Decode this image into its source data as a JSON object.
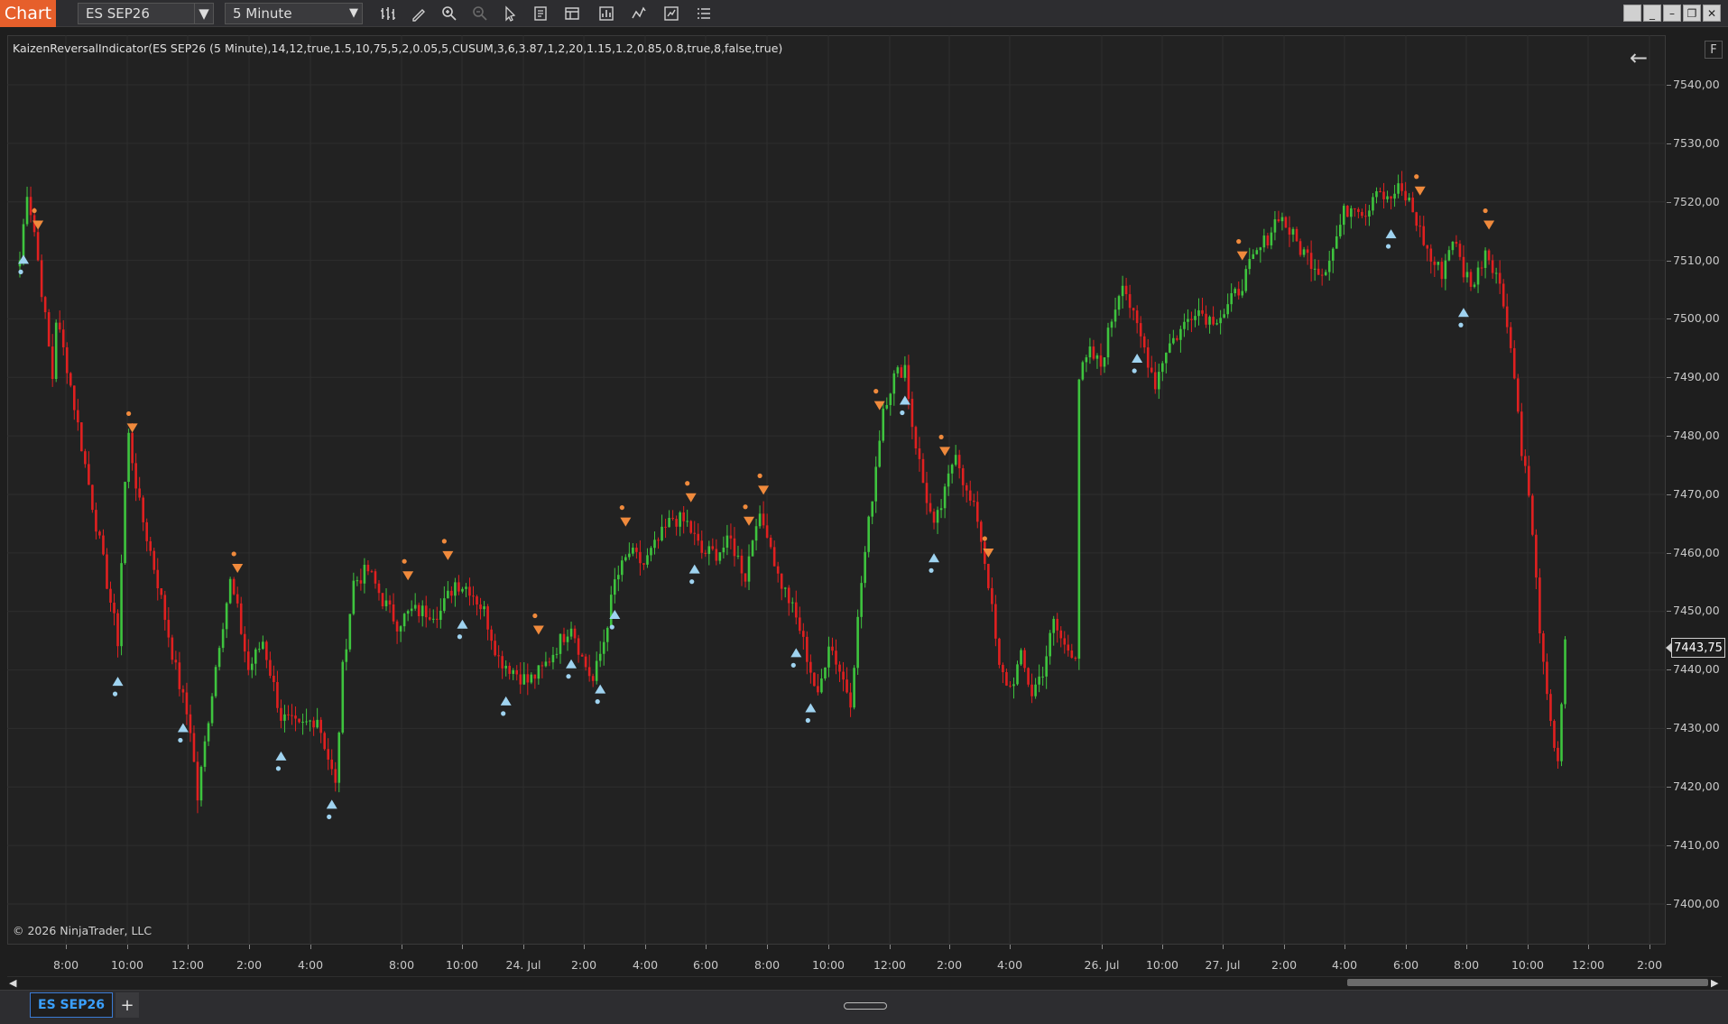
{
  "toolbar": {
    "brand": "Chart",
    "instrument": "ES SEP26",
    "interval": "5 Minute",
    "icons": [
      "bar-type-icon",
      "draw-tool-icon",
      "zoom-in-icon",
      "zoom-out-icon",
      "pointer-icon",
      "data-box-icon",
      "properties-icon",
      "strategy-icon",
      "indicator-icon",
      "templates-icon",
      "chart-trader-icon"
    ],
    "window_buttons": [
      "minimize",
      "maximize",
      "restore",
      "close"
    ]
  },
  "chart": {
    "indicator_label": "KaizenReversalIndicator(ES SEP26 (5 Minute),14,12,true,1.5,10,75,5,2,0.05,5,CUSUM,3,6,3.87,1,2,20,1.15,1.2,0.85,0.8,true,8,false,true)",
    "copyright": "© 2026 NinjaTrader, LLC",
    "last_price": "7443,75",
    "f_button": "F",
    "colors": {
      "up": "#3ec43e",
      "down": "#e02020",
      "buy_signal": "#9fd3f0",
      "sell_signal": "#f08a3c",
      "background": "#222222",
      "grid": "#2e2e2e"
    }
  },
  "price_axis": {
    "ticks": [
      "7540,00",
      "7530,00",
      "7520,00",
      "7510,00",
      "7500,00",
      "7490,00",
      "7480,00",
      "7470,00",
      "7460,00",
      "7450,00",
      "7440,00",
      "7430,00",
      "7420,00",
      "7410,00",
      "7400,00"
    ]
  },
  "time_axis": {
    "ticks": [
      "8:00",
      "10:00",
      "12:00",
      "2:00",
      "4:00",
      "8:00",
      "10:00",
      "24. Jul",
      "2:00",
      "4:00",
      "6:00",
      "8:00",
      "10:00",
      "12:00",
      "2:00",
      "4:00",
      "26. Jul",
      "10:00",
      "27. Jul",
      "2:00",
      "4:00",
      "6:00",
      "8:00",
      "10:00",
      "12:00",
      "2:00"
    ]
  },
  "tabs": {
    "active": "ES SEP26",
    "add": "+"
  },
  "chart_data": {
    "type": "candlestick",
    "instrument": "ES SEP26",
    "interval": "5 Minute",
    "ylim": [
      7395,
      7545
    ],
    "price_path": [
      [
        0,
        7510
      ],
      [
        2,
        7522
      ],
      [
        4,
        7515
      ],
      [
        6,
        7505
      ],
      [
        9,
        7490
      ],
      [
        10,
        7500
      ],
      [
        13,
        7492
      ],
      [
        18,
        7475
      ],
      [
        24,
        7455
      ],
      [
        27,
        7445
      ],
      [
        29,
        7472
      ],
      [
        30,
        7480
      ],
      [
        33,
        7468
      ],
      [
        38,
        7455
      ],
      [
        43,
        7440
      ],
      [
        47,
        7430
      ],
      [
        49,
        7418
      ],
      [
        52,
        7432
      ],
      [
        55,
        7445
      ],
      [
        58,
        7455
      ],
      [
        60,
        7450
      ],
      [
        63,
        7440
      ],
      [
        67,
        7445
      ],
      [
        72,
        7432
      ],
      [
        77,
        7430
      ],
      [
        82,
        7432
      ],
      [
        85,
        7425
      ],
      [
        87,
        7420
      ],
      [
        89,
        7440
      ],
      [
        92,
        7455
      ],
      [
        96,
        7457
      ],
      [
        100,
        7452
      ],
      [
        104,
        7448
      ],
      [
        108,
        7450
      ],
      [
        112,
        7450
      ],
      [
        116,
        7450
      ],
      [
        120,
        7455
      ],
      [
        124,
        7454
      ],
      [
        128,
        7450
      ],
      [
        132,
        7442
      ],
      [
        136,
        7440
      ],
      [
        140,
        7438
      ],
      [
        144,
        7440
      ],
      [
        148,
        7444
      ],
      [
        152,
        7448
      ],
      [
        155,
        7442
      ],
      [
        158,
        7438
      ],
      [
        161,
        7445
      ],
      [
        164,
        7455
      ],
      [
        168,
        7460
      ],
      [
        172,
        7458
      ],
      [
        176,
        7462
      ],
      [
        180,
        7466
      ],
      [
        184,
        7465
      ],
      [
        188,
        7460
      ],
      [
        192,
        7460
      ],
      [
        196,
        7462
      ],
      [
        200,
        7456
      ],
      [
        203,
        7466
      ],
      [
        206,
        7464
      ],
      [
        209,
        7456
      ],
      [
        212,
        7452
      ],
      [
        215,
        7447
      ],
      [
        218,
        7440
      ],
      [
        220,
        7435
      ],
      [
        223,
        7445
      ],
      [
        226,
        7440
      ],
      [
        229,
        7435
      ],
      [
        232,
        7455
      ],
      [
        235,
        7470
      ],
      [
        238,
        7485
      ],
      [
        241,
        7490
      ],
      [
        244,
        7492
      ],
      [
        246,
        7482
      ],
      [
        249,
        7472
      ],
      [
        252,
        7464
      ],
      [
        255,
        7470
      ],
      [
        258,
        7478
      ],
      [
        261,
        7470
      ],
      [
        264,
        7466
      ],
      [
        267,
        7455
      ],
      [
        270,
        7440
      ],
      [
        273,
        7437
      ],
      [
        276,
        7442
      ],
      [
        279,
        7436
      ],
      [
        282,
        7440
      ],
      [
        285,
        7448
      ],
      [
        288,
        7444
      ],
      [
        291,
        7443
      ],
      [
        292,
        7490
      ],
      [
        295,
        7494
      ],
      [
        298,
        7492
      ],
      [
        301,
        7500
      ],
      [
        304,
        7507
      ],
      [
        307,
        7500
      ],
      [
        310,
        7495
      ],
      [
        313,
        7489
      ],
      [
        316,
        7495
      ],
      [
        320,
        7498
      ],
      [
        324,
        7502
      ],
      [
        328,
        7500
      ],
      [
        332,
        7501
      ],
      [
        336,
        7505
      ],
      [
        340,
        7510
      ],
      [
        344,
        7514
      ],
      [
        347,
        7518
      ],
      [
        350,
        7515
      ],
      [
        353,
        7512
      ],
      [
        356,
        7510
      ],
      [
        359,
        7508
      ],
      [
        362,
        7512
      ],
      [
        365,
        7518
      ],
      [
        368,
        7520
      ],
      [
        371,
        7518
      ],
      [
        374,
        7523
      ],
      [
        377,
        7520
      ],
      [
        380,
        7522
      ],
      [
        383,
        7520
      ],
      [
        386,
        7515
      ],
      [
        389,
        7510
      ],
      [
        392,
        7508
      ],
      [
        395,
        7514
      ],
      [
        398,
        7508
      ],
      [
        401,
        7506
      ],
      [
        404,
        7512
      ],
      [
        407,
        7508
      ],
      [
        410,
        7500
      ],
      [
        412,
        7490
      ],
      [
        414,
        7478
      ],
      [
        416,
        7470
      ],
      [
        418,
        7455
      ],
      [
        420,
        7440
      ],
      [
        422,
        7430
      ],
      [
        424,
        7425
      ],
      [
        426,
        7444
      ]
    ],
    "buy_signals_at": [
      1,
      27,
      45,
      72,
      86,
      122,
      134,
      152,
      160,
      164,
      186,
      214,
      218,
      244,
      252,
      308,
      378,
      398
    ],
    "sell_signals_at": [
      5,
      31,
      60,
      107,
      118,
      143,
      167,
      185,
      201,
      205,
      237,
      255,
      267,
      337,
      386,
      405
    ]
  }
}
